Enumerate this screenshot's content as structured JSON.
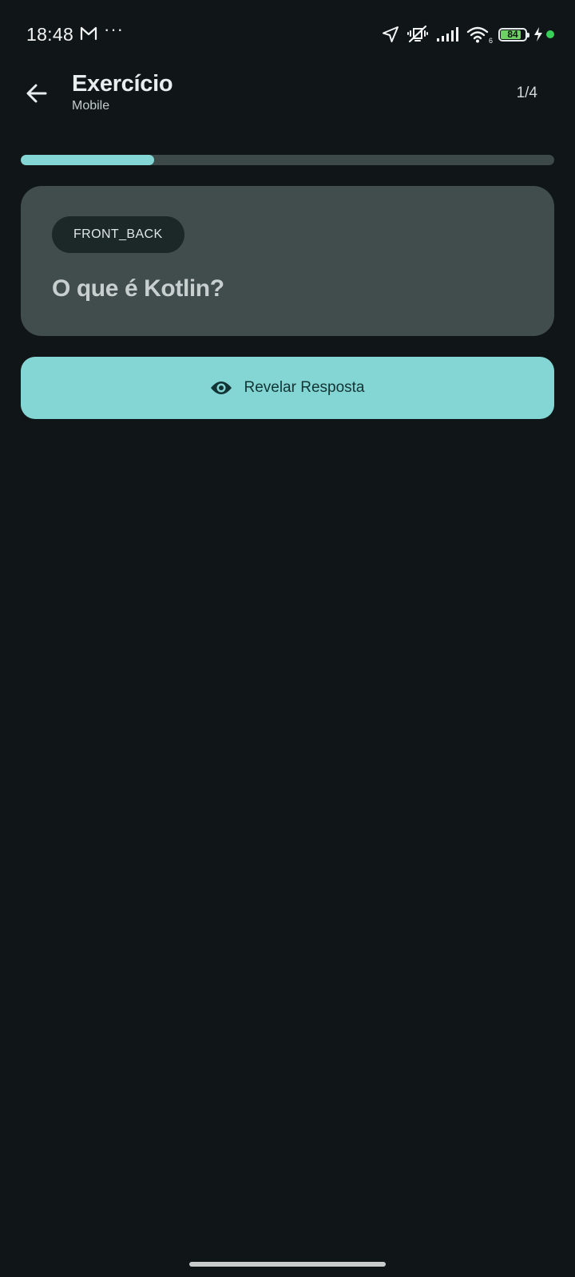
{
  "status_bar": {
    "time": "18:48",
    "notification_icons": [
      "gmail-icon",
      "more-dots-icon"
    ],
    "more_indicator": "···",
    "system_icons": [
      "location-arrow-icon",
      "vibrate-silent-icon",
      "signal-bars-icon",
      "wifi-icon"
    ],
    "wifi_badge": "6",
    "battery_level": "84",
    "battery_fraction": 0.84,
    "charging": true
  },
  "header": {
    "back_icon": "arrow-left-icon",
    "title": "Exercício",
    "subtitle": "Mobile",
    "counter": "1/4"
  },
  "progress": {
    "value": 0.25
  },
  "card": {
    "type_chip": "FRONT_BACK",
    "question": "O que é Kotlin?"
  },
  "reveal_button": {
    "icon": "eye-icon",
    "label": "Revelar Resposta"
  },
  "colors": {
    "background": "#101617",
    "accent": "#84d6d4",
    "card": "#414c4c",
    "progress_track": "#3d4849",
    "chip": "#1c2828"
  }
}
